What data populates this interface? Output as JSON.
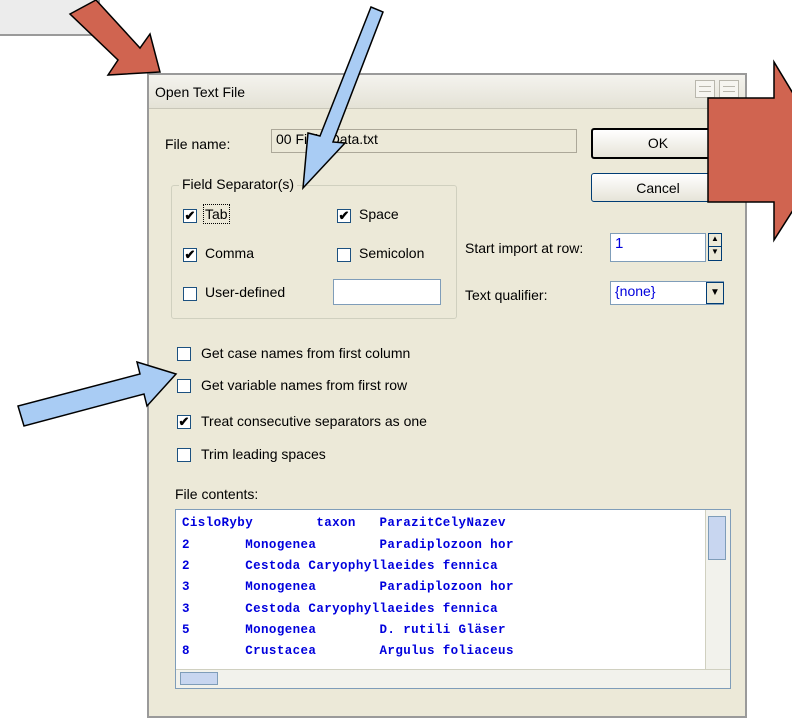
{
  "dialog": {
    "title": "Open Text File",
    "file_name_label": "File name:",
    "file_name_value": "00 Field Data.txt",
    "ok_label": "OK",
    "cancel_label": "Cancel",
    "field_separators": {
      "legend": "Field Separator(s)",
      "tab": {
        "label": "Tab",
        "checked": true
      },
      "space": {
        "label": "Space",
        "checked": true
      },
      "comma": {
        "label": "Comma",
        "checked": true
      },
      "semicolon": {
        "label": "Semicolon",
        "checked": false
      },
      "user_defined": {
        "label": "User-defined",
        "checked": false,
        "value": ""
      }
    },
    "start_import_label": "Start import at row:",
    "start_import_value": "1",
    "text_qualifier_label": "Text qualifier:",
    "text_qualifier_value": "{none}",
    "options": [
      {
        "label": "Get case names from first column",
        "checked": false
      },
      {
        "label": "Get variable names from first row",
        "checked": false
      },
      {
        "label": "Treat consecutive separators as one",
        "checked": true
      },
      {
        "label": "Trim leading spaces",
        "checked": false
      }
    ],
    "file_contents_label": "File contents:",
    "file_contents": [
      "CisloRyby        taxon   ParazitCelyNazev",
      "2       Monogenea        Paradiplozoon hor",
      "2       Cestoda Caryophyllaeides fennica",
      "3       Monogenea        Paradiplozoon hor",
      "3       Cestoda Caryophyllaeides fennica",
      "5       Monogenea        D. rutili Gläser",
      "8       Crustacea        Argulus foliaceus"
    ]
  },
  "annotations": {
    "arrow_red_color": "#d06450",
    "arrow_blue_color": "#a9ccf4",
    "arrow_outline_color": "#000000"
  }
}
